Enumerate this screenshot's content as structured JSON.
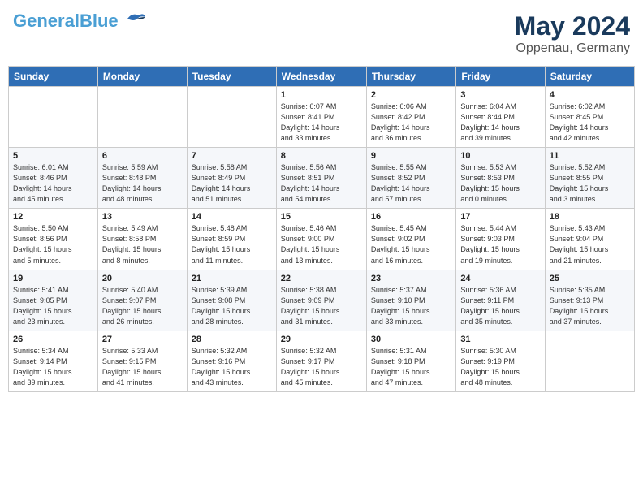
{
  "logo": {
    "name_part1": "General",
    "name_part2": "Blue"
  },
  "title": {
    "month_year": "May 2024",
    "location": "Oppenau, Germany"
  },
  "weekdays": [
    "Sunday",
    "Monday",
    "Tuesday",
    "Wednesday",
    "Thursday",
    "Friday",
    "Saturday"
  ],
  "weeks": [
    [
      {
        "day": "",
        "info": ""
      },
      {
        "day": "",
        "info": ""
      },
      {
        "day": "",
        "info": ""
      },
      {
        "day": "1",
        "info": "Sunrise: 6:07 AM\nSunset: 8:41 PM\nDaylight: 14 hours\nand 33 minutes."
      },
      {
        "day": "2",
        "info": "Sunrise: 6:06 AM\nSunset: 8:42 PM\nDaylight: 14 hours\nand 36 minutes."
      },
      {
        "day": "3",
        "info": "Sunrise: 6:04 AM\nSunset: 8:44 PM\nDaylight: 14 hours\nand 39 minutes."
      },
      {
        "day": "4",
        "info": "Sunrise: 6:02 AM\nSunset: 8:45 PM\nDaylight: 14 hours\nand 42 minutes."
      }
    ],
    [
      {
        "day": "5",
        "info": "Sunrise: 6:01 AM\nSunset: 8:46 PM\nDaylight: 14 hours\nand 45 minutes."
      },
      {
        "day": "6",
        "info": "Sunrise: 5:59 AM\nSunset: 8:48 PM\nDaylight: 14 hours\nand 48 minutes."
      },
      {
        "day": "7",
        "info": "Sunrise: 5:58 AM\nSunset: 8:49 PM\nDaylight: 14 hours\nand 51 minutes."
      },
      {
        "day": "8",
        "info": "Sunrise: 5:56 AM\nSunset: 8:51 PM\nDaylight: 14 hours\nand 54 minutes."
      },
      {
        "day": "9",
        "info": "Sunrise: 5:55 AM\nSunset: 8:52 PM\nDaylight: 14 hours\nand 57 minutes."
      },
      {
        "day": "10",
        "info": "Sunrise: 5:53 AM\nSunset: 8:53 PM\nDaylight: 15 hours\nand 0 minutes."
      },
      {
        "day": "11",
        "info": "Sunrise: 5:52 AM\nSunset: 8:55 PM\nDaylight: 15 hours\nand 3 minutes."
      }
    ],
    [
      {
        "day": "12",
        "info": "Sunrise: 5:50 AM\nSunset: 8:56 PM\nDaylight: 15 hours\nand 5 minutes."
      },
      {
        "day": "13",
        "info": "Sunrise: 5:49 AM\nSunset: 8:58 PM\nDaylight: 15 hours\nand 8 minutes."
      },
      {
        "day": "14",
        "info": "Sunrise: 5:48 AM\nSunset: 8:59 PM\nDaylight: 15 hours\nand 11 minutes."
      },
      {
        "day": "15",
        "info": "Sunrise: 5:46 AM\nSunset: 9:00 PM\nDaylight: 15 hours\nand 13 minutes."
      },
      {
        "day": "16",
        "info": "Sunrise: 5:45 AM\nSunset: 9:02 PM\nDaylight: 15 hours\nand 16 minutes."
      },
      {
        "day": "17",
        "info": "Sunrise: 5:44 AM\nSunset: 9:03 PM\nDaylight: 15 hours\nand 19 minutes."
      },
      {
        "day": "18",
        "info": "Sunrise: 5:43 AM\nSunset: 9:04 PM\nDaylight: 15 hours\nand 21 minutes."
      }
    ],
    [
      {
        "day": "19",
        "info": "Sunrise: 5:41 AM\nSunset: 9:05 PM\nDaylight: 15 hours\nand 23 minutes."
      },
      {
        "day": "20",
        "info": "Sunrise: 5:40 AM\nSunset: 9:07 PM\nDaylight: 15 hours\nand 26 minutes."
      },
      {
        "day": "21",
        "info": "Sunrise: 5:39 AM\nSunset: 9:08 PM\nDaylight: 15 hours\nand 28 minutes."
      },
      {
        "day": "22",
        "info": "Sunrise: 5:38 AM\nSunset: 9:09 PM\nDaylight: 15 hours\nand 31 minutes."
      },
      {
        "day": "23",
        "info": "Sunrise: 5:37 AM\nSunset: 9:10 PM\nDaylight: 15 hours\nand 33 minutes."
      },
      {
        "day": "24",
        "info": "Sunrise: 5:36 AM\nSunset: 9:11 PM\nDaylight: 15 hours\nand 35 minutes."
      },
      {
        "day": "25",
        "info": "Sunrise: 5:35 AM\nSunset: 9:13 PM\nDaylight: 15 hours\nand 37 minutes."
      }
    ],
    [
      {
        "day": "26",
        "info": "Sunrise: 5:34 AM\nSunset: 9:14 PM\nDaylight: 15 hours\nand 39 minutes."
      },
      {
        "day": "27",
        "info": "Sunrise: 5:33 AM\nSunset: 9:15 PM\nDaylight: 15 hours\nand 41 minutes."
      },
      {
        "day": "28",
        "info": "Sunrise: 5:32 AM\nSunset: 9:16 PM\nDaylight: 15 hours\nand 43 minutes."
      },
      {
        "day": "29",
        "info": "Sunrise: 5:32 AM\nSunset: 9:17 PM\nDaylight: 15 hours\nand 45 minutes."
      },
      {
        "day": "30",
        "info": "Sunrise: 5:31 AM\nSunset: 9:18 PM\nDaylight: 15 hours\nand 47 minutes."
      },
      {
        "day": "31",
        "info": "Sunrise: 5:30 AM\nSunset: 9:19 PM\nDaylight: 15 hours\nand 48 minutes."
      },
      {
        "day": "",
        "info": ""
      }
    ]
  ]
}
